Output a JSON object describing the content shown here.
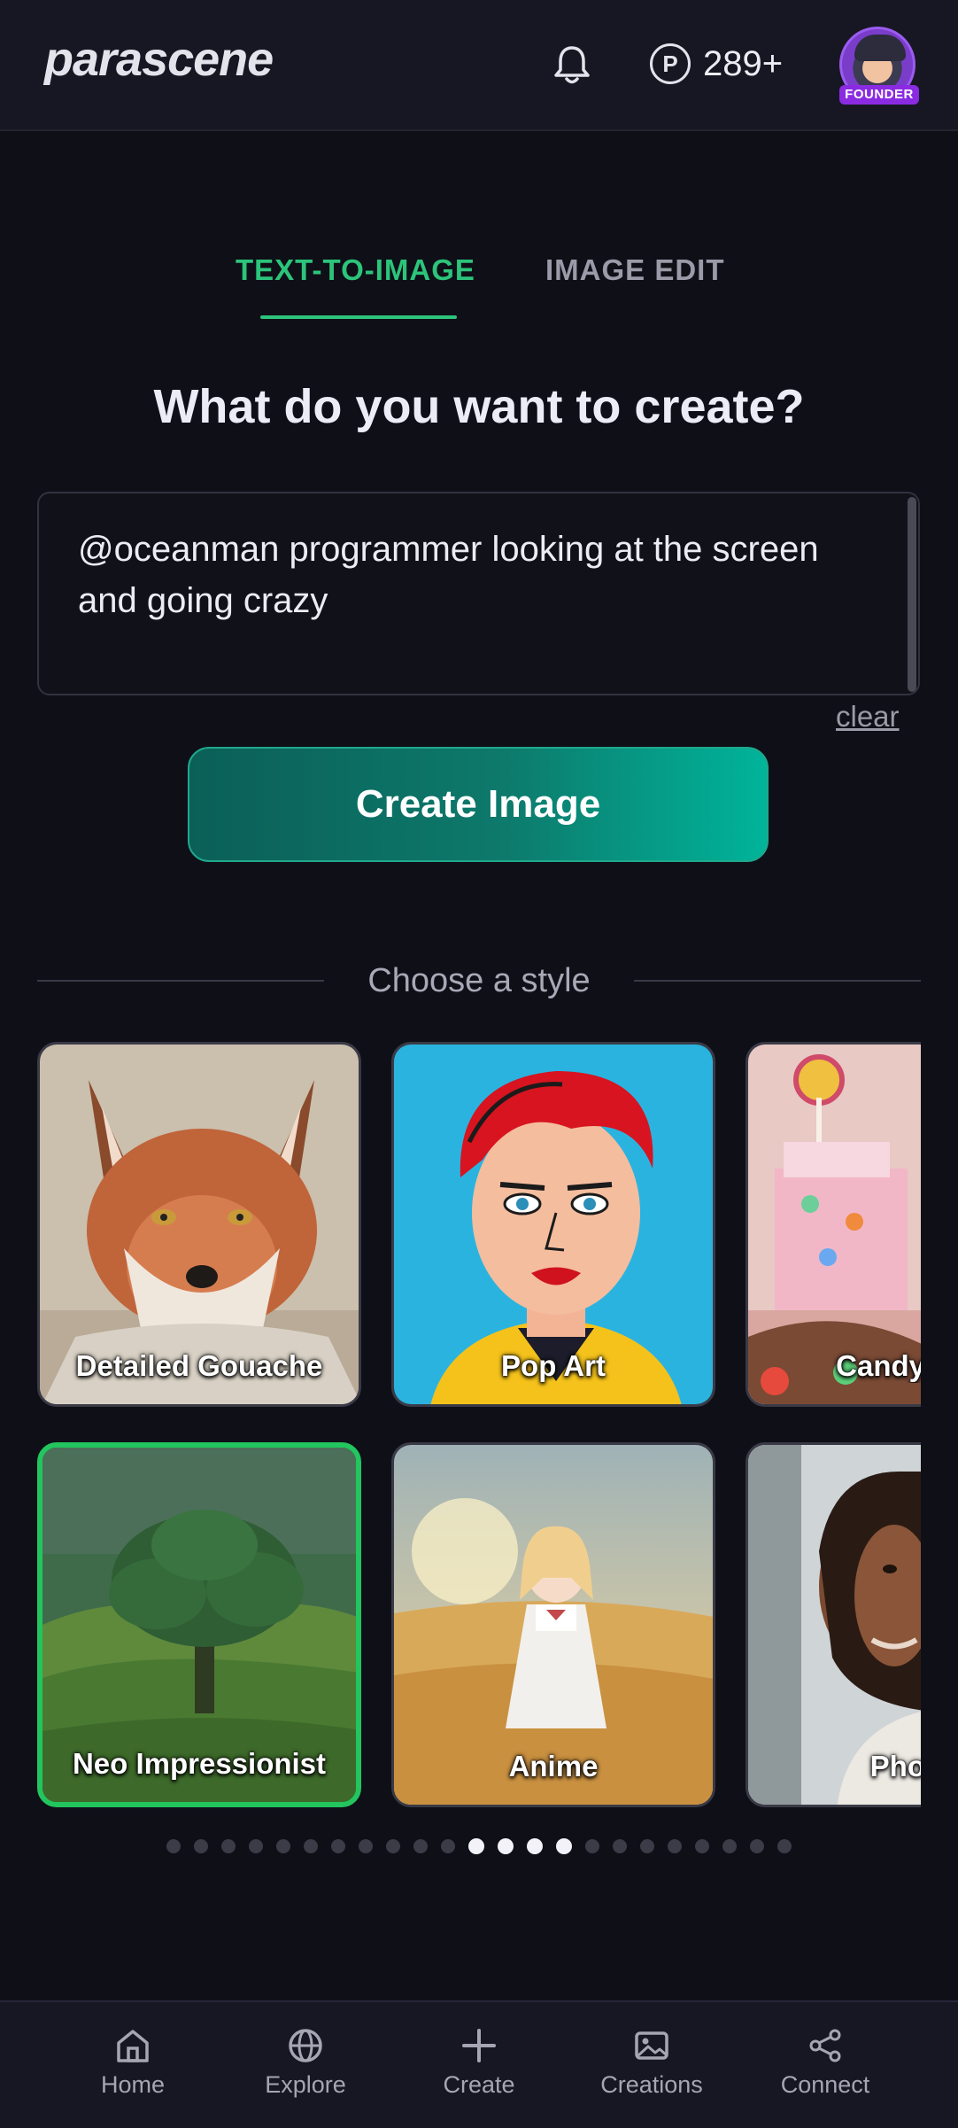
{
  "header": {
    "logo_text": "parascene",
    "credits_symbol": "P",
    "credits_count": "289+",
    "avatar_badge": "FOUNDER",
    "icons": [
      "bell-icon",
      "credits-icon",
      "avatar"
    ]
  },
  "tabs": [
    {
      "label": "TEXT-TO-IMAGE",
      "active": true
    },
    {
      "label": "IMAGE EDIT",
      "active": false
    }
  ],
  "heading": "What do you want to create?",
  "prompt": {
    "value": "@oceanman programmer looking at the screen and going crazy",
    "clear_label": "clear"
  },
  "create_button_label": "Create Image",
  "style_section_label": "Choose a style",
  "styles": [
    {
      "label": "Detailed Gouache",
      "selected": false
    },
    {
      "label": "Pop Art",
      "selected": false
    },
    {
      "label": "Candy",
      "selected": false
    },
    {
      "label": "Neo Impressionist",
      "selected": true
    },
    {
      "label": "Anime",
      "selected": false
    },
    {
      "label": "Pho",
      "selected": false
    }
  ],
  "pagination": {
    "total": 23,
    "active_indices": [
      11,
      12,
      13,
      14
    ]
  },
  "bottom_nav": [
    {
      "label": "Home",
      "icon": "home-icon"
    },
    {
      "label": "Explore",
      "icon": "globe-icon"
    },
    {
      "label": "Create",
      "icon": "plus-icon"
    },
    {
      "label": "Creations",
      "icon": "image-icon"
    },
    {
      "label": "Connect",
      "icon": "share-icon"
    }
  ],
  "colors": {
    "background": "#0f0f18",
    "accent_green": "#2cc47a",
    "button_teal": "#00b49a",
    "selected_border": "#22c55e",
    "founder_badge": "#8a2be2"
  }
}
